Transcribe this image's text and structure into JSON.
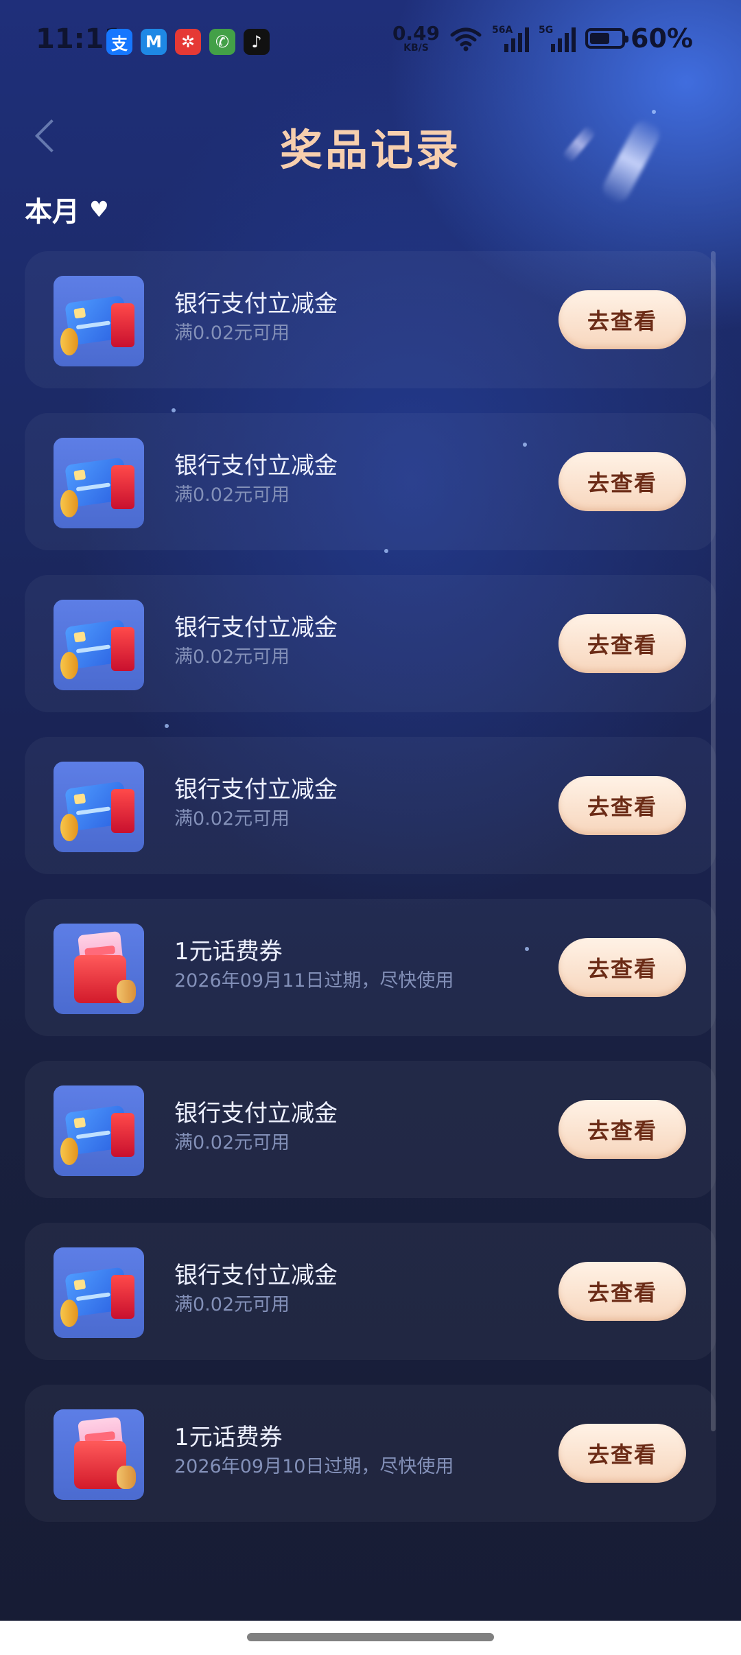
{
  "status_bar": {
    "time": "11:11",
    "apps": [
      {
        "name": "alipay",
        "glyph": "支",
        "color": "#1677ff"
      },
      {
        "name": "maps",
        "glyph": "M",
        "color": "#1e88e5"
      },
      {
        "name": "huawei-app",
        "glyph": "✲",
        "color": "#e53935"
      },
      {
        "name": "phone",
        "glyph": "✆",
        "color": "#43a047"
      },
      {
        "name": "tiktok",
        "glyph": "♪",
        "color": "#111111"
      }
    ],
    "speed_value": "0.49",
    "speed_unit": "KB/S",
    "net1": "56A",
    "net2": "5G",
    "battery": "60%"
  },
  "header": {
    "title": "奖品记录",
    "filter_label": "本月"
  },
  "rewards": [
    {
      "type": "bank",
      "name": "银行支付立减金",
      "desc": "满0.02元可用",
      "button": "去查看"
    },
    {
      "type": "bank",
      "name": "银行支付立减金",
      "desc": "满0.02元可用",
      "button": "去查看"
    },
    {
      "type": "bank",
      "name": "银行支付立减金",
      "desc": "满0.02元可用",
      "button": "去查看"
    },
    {
      "type": "bank",
      "name": "银行支付立减金",
      "desc": "满0.02元可用",
      "button": "去查看"
    },
    {
      "type": "phone",
      "name": "1元话费券",
      "desc": "2026年09月11日过期，尽快使用",
      "button": "去查看"
    },
    {
      "type": "bank",
      "name": "银行支付立减金",
      "desc": "满0.02元可用",
      "button": "去查看"
    },
    {
      "type": "bank",
      "name": "银行支付立减金",
      "desc": "满0.02元可用",
      "button": "去查看"
    },
    {
      "type": "phone",
      "name": "1元话费券",
      "desc": "2026年09月10日过期，尽快使用",
      "button": "去查看"
    }
  ]
}
